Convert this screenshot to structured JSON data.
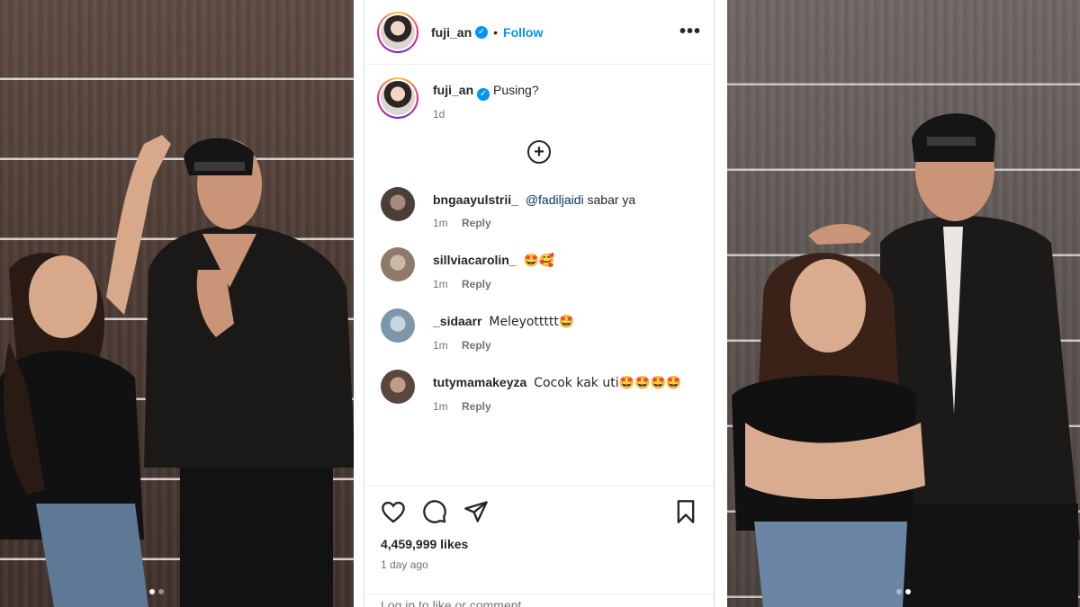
{
  "post": {
    "author": {
      "username": "fuji_an",
      "verified": true
    },
    "header": {
      "separator": "•",
      "follow_label": "Follow",
      "more_label": "•••"
    },
    "caption": {
      "text": "Pusing?",
      "age": "1d"
    },
    "load_more_label": "+",
    "comments": [
      {
        "username": "bngaayulstrii_",
        "mention": "@fadiljaidi",
        "text": "sabar ya",
        "age": "1m",
        "reply_label": "Reply"
      },
      {
        "username": "sillviacarolin_",
        "mention": "",
        "text": "🤩🥰",
        "age": "1m",
        "reply_label": "Reply"
      },
      {
        "username": "_sidaarr",
        "mention": "",
        "text": "Meleyottttt🤩",
        "age": "1m",
        "reply_label": "Reply"
      },
      {
        "username": "tutymamakeyza",
        "mention": "",
        "text": "Cocok kak uti🤩🤩🤩🤩",
        "age": "1m",
        "reply_label": "Reply"
      }
    ],
    "actions": {
      "icons": [
        "heart-icon",
        "comment-icon",
        "share-icon",
        "bookmark-icon"
      ]
    },
    "likes": "4,459,999 likes",
    "posted_ago": "1 day ago",
    "add_comment_placeholder": "Log in to like or comment."
  },
  "carousel": {
    "left_dots": 2,
    "left_active": 1,
    "right_dots": 2,
    "right_active": 2
  },
  "colors": {
    "accent": "#0095f6",
    "text": "#262626",
    "muted": "#737373"
  }
}
